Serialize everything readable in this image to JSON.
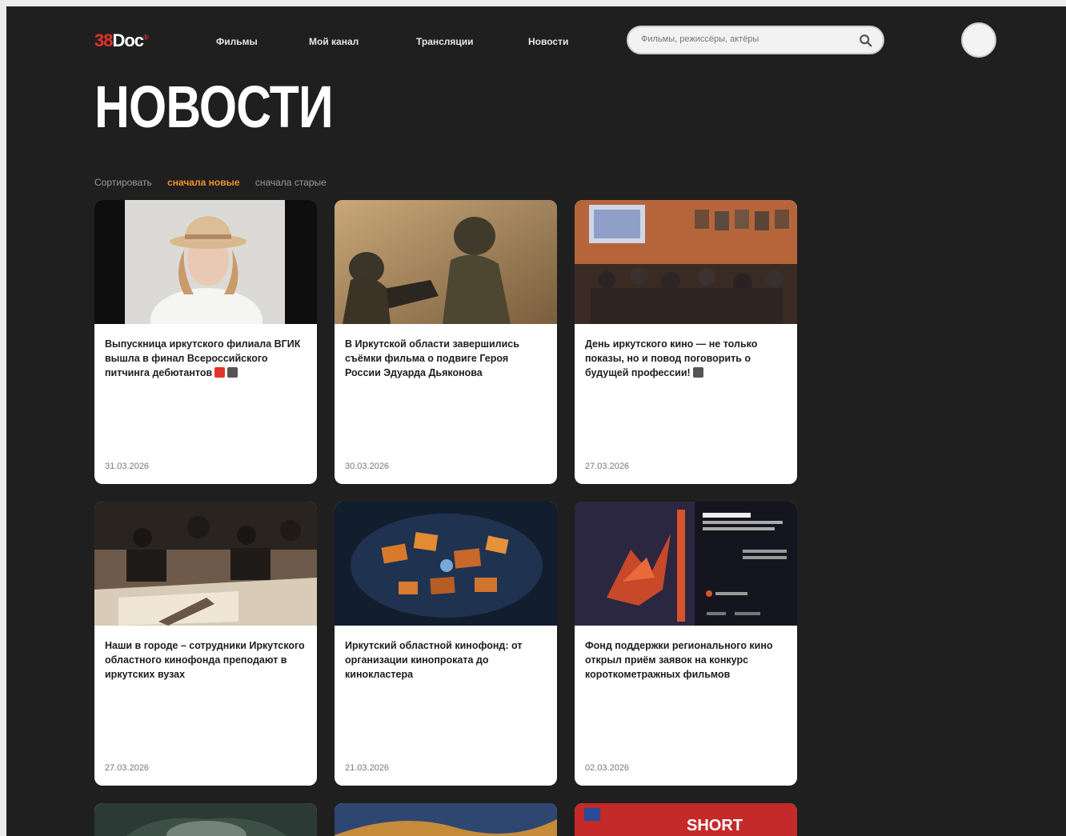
{
  "header": {
    "logo": {
      "num": "38",
      "text": "Doc",
      "mark": "®"
    },
    "nav": [
      {
        "label": "Фильмы"
      },
      {
        "label": "Мой канал"
      },
      {
        "label": "Трансляции"
      },
      {
        "label": "Новости"
      }
    ],
    "search": {
      "placeholder": "Фильмы, режиссёры, актёры",
      "icon": "search-icon"
    },
    "avatar": "user-avatar"
  },
  "page": {
    "title": "НОВОСТИ"
  },
  "sort": {
    "label": "Сортировать",
    "options": [
      {
        "label": "сначала новые",
        "active": true
      },
      {
        "label": "сначала старые",
        "active": false
      }
    ]
  },
  "cards": [
    {
      "title": "Выпускница иркутского филиала ВГИК вышла в финал Всероссийского питчинга дебютантов",
      "flags": [
        "red",
        "film"
      ],
      "date": "31.03.2026"
    },
    {
      "title": "В Иркутской области завершились съёмки фильма о подвиге Героя России Эдуарда Дьяконова",
      "flags": [],
      "date": "30.03.2026"
    },
    {
      "title": "День иркутского кино — не только показы, но и повод поговорить о будущей профессии!",
      "flags": [
        "film"
      ],
      "date": "27.03.2026"
    },
    {
      "title": "Наши в городе – сотрудники Иркутского областного кинофонда преподают в иркутских вузах",
      "flags": [],
      "date": "27.03.2026"
    },
    {
      "title": "Иркутский областной кинофонд: от организации кинопроката до кинокластера",
      "flags": [],
      "date": "21.03.2026"
    },
    {
      "title": "Фонд поддержки регионального кино открыл приём заявок на конкурс короткометражных фильмов",
      "flags": [],
      "date": "02.03.2026"
    }
  ],
  "partial_cards": [
    {
      "text": ""
    },
    {
      "text": ""
    },
    {
      "text": "SHORT"
    }
  ]
}
